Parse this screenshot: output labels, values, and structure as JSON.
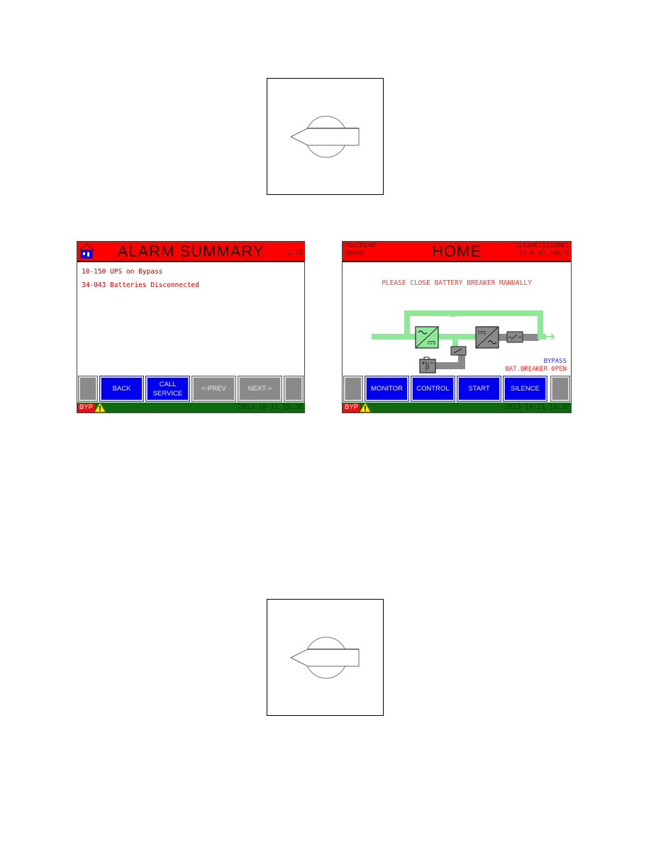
{
  "figures": {
    "top_knob": {
      "icon": "rotary-switch-knob"
    },
    "bottom_knob": {
      "icon": "rotary-switch-knob"
    }
  },
  "alarm_screen": {
    "title": "ALARM SUMMARY",
    "version": "1.15",
    "home_icon": "home-icon",
    "alarms": [
      {
        "code": "10-150",
        "text": "UPS on Bypass"
      },
      {
        "code": "34-043",
        "text": "Batteries Disconnected"
      }
    ],
    "alarm_lines": [
      "10-150 UPS on Bypass",
      "34-043 Batteries Disconnected"
    ],
    "buttons": {
      "back": "BACK",
      "call_service_line1": "CALL",
      "call_service_line2": "SERVICE",
      "prev": "<-PREV",
      "next": "NEXT->"
    },
    "status_bar": {
      "mode": "BYP",
      "warning_icon": "warning-icon",
      "datetime": "2013-10-11 15:30"
    }
  },
  "home_screen": {
    "brand": "POWERVAR",
    "rating": "30KVA",
    "title": "HOME",
    "serial": "32030011310001",
    "firmware": "V1.0.42.10475",
    "notice": "PLEASE CLOSE BATTERY BREAKER MANUALLY",
    "state_line1": "BYPASS",
    "state_line2": "BAT.BREAKER OPEN",
    "buttons": {
      "monitor": "MONITOR",
      "control": "CONTROL",
      "start": "START",
      "silence": "SILENCE"
    },
    "status_bar": {
      "mode": "BYP",
      "warning_icon": "warning-icon",
      "datetime": "2013-10-11 15:32"
    },
    "colors": {
      "active_path": "#8fe89a",
      "inactive_path": "#8a8a8a",
      "state_bypass": "#3333ff",
      "state_breaker": "#ff2222"
    }
  }
}
